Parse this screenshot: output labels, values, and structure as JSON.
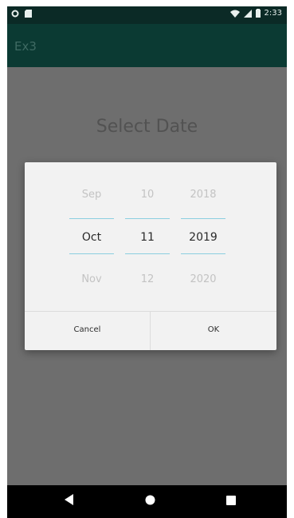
{
  "status_bar": {
    "time": "2:33"
  },
  "app_bar": {
    "title": "Ex3"
  },
  "main": {
    "heading": "Select Date"
  },
  "date_picker": {
    "month": {
      "prev": "Sep",
      "selected": "Oct",
      "next": "Nov"
    },
    "day": {
      "prev": "10",
      "selected": "11",
      "next": "12"
    },
    "year": {
      "prev": "2018",
      "selected": "2019",
      "next": "2020"
    },
    "cancel_label": "Cancel",
    "ok_label": "OK"
  },
  "nav_bar": {
    "icons": [
      "back-icon",
      "home-icon",
      "recents-icon"
    ]
  },
  "colors": {
    "status_bar": "#0b2a26",
    "app_bar": "#0b3a33",
    "accent_line": "#8ccfe0",
    "scrim": "#6e6e6e"
  }
}
